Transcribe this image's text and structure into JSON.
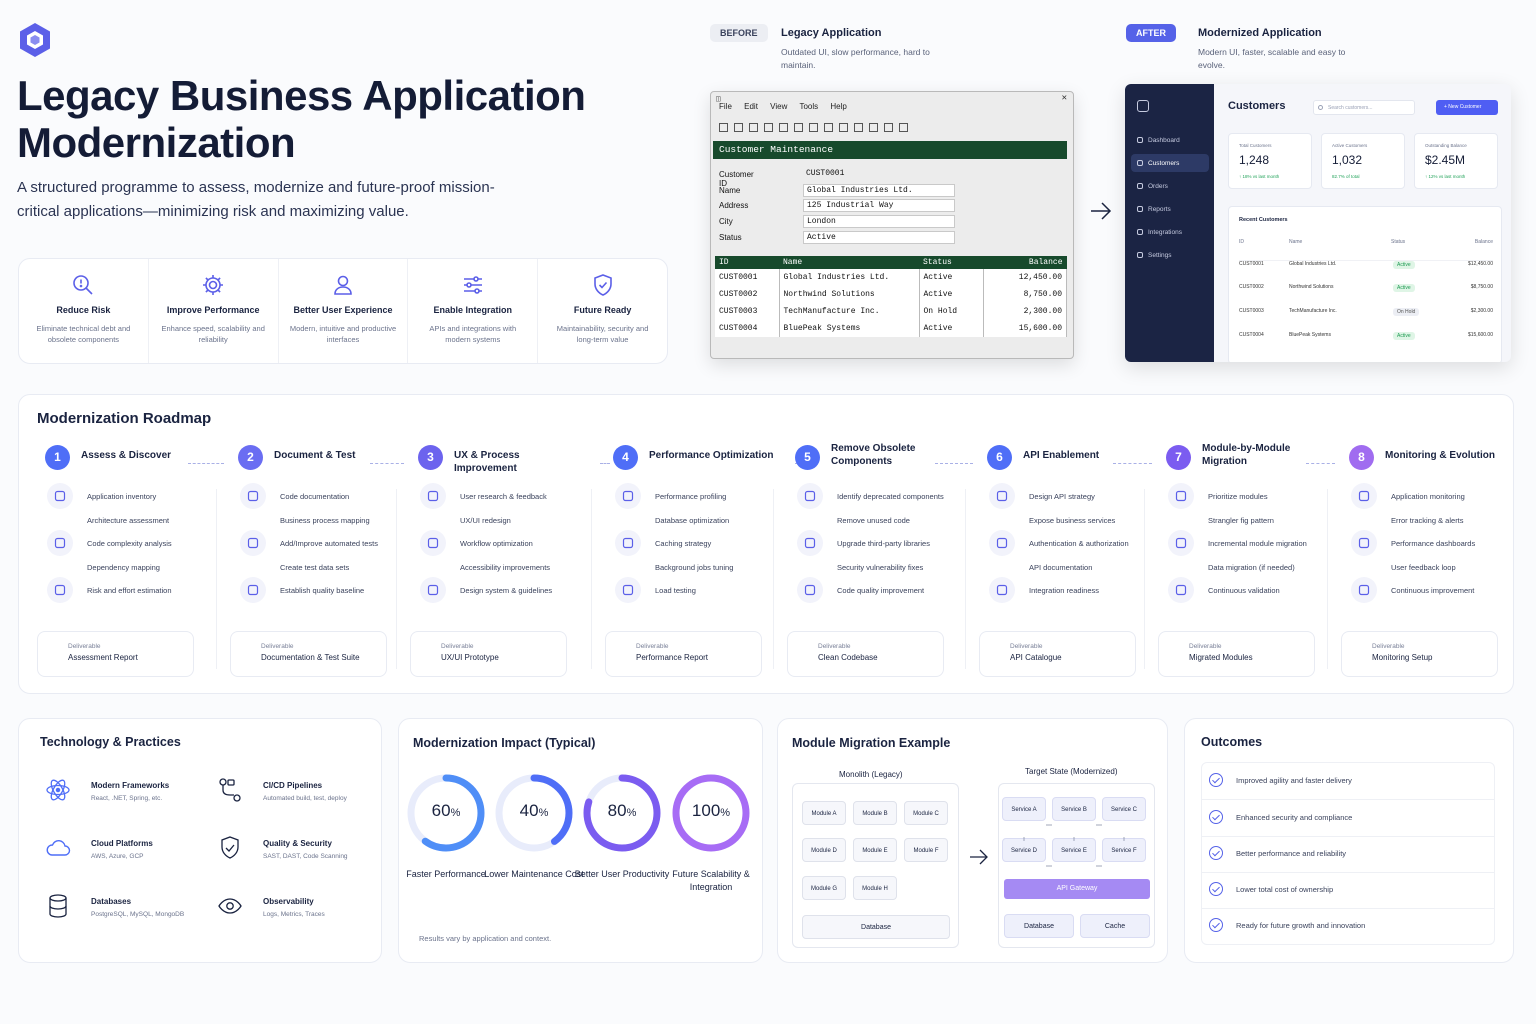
{
  "hero": {
    "title_line1": "Legacy Business Application",
    "title_line2": "Modernization",
    "lead": "A structured programme to assess, modernize and future-proof mission-critical applications—minimizing risk and maximizing value.",
    "goals": [
      {
        "icon": "search-risk-icon",
        "title": "Reduce Risk",
        "desc": "Eliminate technical debt and obsolete components"
      },
      {
        "icon": "gear-icon",
        "title": "Improve Performance",
        "desc": "Enhance speed, scalability and reliability"
      },
      {
        "icon": "user-icon",
        "title": "Better User Experience",
        "desc": "Modern, intuitive and productive interfaces"
      },
      {
        "icon": "sliders-icon",
        "title": "Enable Integration",
        "desc": "APIs and integrations with modern systems"
      },
      {
        "icon": "shield-check-icon",
        "title": "Future Ready",
        "desc": "Maintainability, security and long-term value"
      }
    ]
  },
  "before": {
    "pill": "BEFORE",
    "title": "Legacy Application",
    "desc": "Outdated UI, slow performance, hard to maintain.",
    "menu": [
      "File",
      "Edit",
      "View",
      "Tools",
      "Help"
    ],
    "window_title": "Customer Maintenance",
    "form": [
      {
        "label": "Customer ID",
        "value": "CUST0001",
        "boxed": false
      },
      {
        "label": "Name",
        "value": "Global Industries Ltd.",
        "boxed": true
      },
      {
        "label": "Address",
        "value": "125 Industrial Way",
        "boxed": true
      },
      {
        "label": "City",
        "value": "London",
        "boxed": true
      },
      {
        "label": "Status",
        "value": "Active",
        "boxed": true
      }
    ],
    "columns": [
      "ID",
      "Name",
      "Status",
      "Balance"
    ],
    "rows": [
      [
        "CUST0001",
        "Global Industries Ltd.",
        "Active",
        "12,450.00"
      ],
      [
        "CUST0002",
        "Northwind Solutions",
        "Active",
        "8,750.00"
      ],
      [
        "CUST0003",
        "TechManufacture Inc.",
        "On Hold",
        "2,300.00"
      ],
      [
        "CUST0004",
        "BluePeak Systems",
        "Active",
        "15,600.00"
      ]
    ]
  },
  "after": {
    "pill": "AFTER",
    "title": "Modernized Application",
    "desc": "Modern UI, faster, scalable and easy to evolve.",
    "nav": [
      "Dashboard",
      "Customers",
      "Orders",
      "Reports",
      "Integrations",
      "Settings"
    ],
    "page_title": "Customers",
    "search_placeholder": "Search customers...",
    "new_button": "+ New Customer",
    "kpis": [
      {
        "label": "Total Customers",
        "value": "1,248",
        "sub": "↑ 18% vs last month"
      },
      {
        "label": "Active Customers",
        "value": "1,032",
        "sub": "82.7% of total"
      },
      {
        "label": "Outstanding Balance",
        "value": "$2.45M",
        "sub": "↑ 12% vs last month"
      }
    ],
    "recent_title": "Recent Customers",
    "columns": [
      "ID",
      "Name",
      "Status",
      "Balance"
    ],
    "rows": [
      [
        "CUST0001",
        "Global Industries Ltd.",
        "Active",
        "$12,450.00"
      ],
      [
        "CUST0002",
        "Northwind Solutions",
        "Active",
        "$8,750.00"
      ],
      [
        "CUST0003",
        "TechManufacture Inc.",
        "On Hold",
        "$2,300.00"
      ],
      [
        "CUST0004",
        "BluePeak Systems",
        "Active",
        "$15,600.00"
      ]
    ]
  },
  "roadmap": {
    "title": "Modernization Roadmap",
    "stages": [
      {
        "num": "1",
        "title": "Assess & Discover",
        "color": "#4f6ef7",
        "items": [
          "Application inventory",
          "Architecture assessment",
          "Code complexity analysis",
          "Dependency mapping",
          "Risk and effort estimation"
        ],
        "deliverable": "Assessment Report"
      },
      {
        "num": "2",
        "title": "Document & Test",
        "color": "#6a6df2",
        "items": [
          "Code documentation",
          "Business process mapping",
          "Add/Improve automated tests",
          "Create test data sets",
          "Establish quality baseline"
        ],
        "deliverable": "Documentation & Test Suite"
      },
      {
        "num": "3",
        "title": "UX & Process Improvement",
        "color": "#6c63ee",
        "items": [
          "User research & feedback",
          "UX/UI redesign",
          "Workflow optimization",
          "Accessibility improvements",
          "Design system & guidelines"
        ],
        "deliverable": "UX/UI Prototype"
      },
      {
        "num": "4",
        "title": "Performance Optimization",
        "color": "#4f6ef7",
        "items": [
          "Performance profiling",
          "Database optimization",
          "Caching strategy",
          "Background jobs tuning",
          "Load testing"
        ],
        "deliverable": "Performance Report"
      },
      {
        "num": "5",
        "title": "Remove Obsolete Components",
        "color": "#4f6ef7",
        "items": [
          "Identify deprecated components",
          "Remove unused code",
          "Upgrade third-party libraries",
          "Security vulnerability fixes",
          "Code quality improvement"
        ],
        "deliverable": "Clean Codebase"
      },
      {
        "num": "6",
        "title": "API Enablement",
        "color": "#4f6ef7",
        "items": [
          "Design API strategy",
          "Expose business services",
          "Authentication & authorization",
          "API documentation",
          "Integration readiness"
        ],
        "deliverable": "API Catalogue"
      },
      {
        "num": "7",
        "title": "Module-by-Module Migration",
        "color": "#7b5cf0",
        "items": [
          "Prioritize modules",
          "Strangler fig pattern",
          "Incremental module migration",
          "Data migration (if needed)",
          "Continuous validation"
        ],
        "deliverable": "Migrated Modules"
      },
      {
        "num": "8",
        "title": "Monitoring & Evolution",
        "color": "#a06cf0",
        "items": [
          "Application monitoring",
          "Error tracking & alerts",
          "Performance dashboards",
          "User feedback loop",
          "Continuous improvement"
        ],
        "deliverable": "Monitoring Setup"
      }
    ],
    "deliverable_label": "Deliverable"
  },
  "tech": {
    "title": "Technology & Practices",
    "items": [
      {
        "icon": "atom-icon",
        "title": "Modern Frameworks",
        "desc": "React, .NET, Spring, etc."
      },
      {
        "icon": "pipeline-icon",
        "title": "CI/CD Pipelines",
        "desc": "Automated build, test, deploy"
      },
      {
        "icon": "cloud-icon",
        "title": "Cloud Platforms",
        "desc": "AWS, Azure, GCP"
      },
      {
        "icon": "shield-check-icon",
        "title": "Quality & Security",
        "desc": "SAST, DAST, Code Scanning"
      },
      {
        "icon": "database-icon",
        "title": "Databases",
        "desc": "PostgreSQL, MySQL, MongoDB"
      },
      {
        "icon": "eye-icon",
        "title": "Observability",
        "desc": "Logs, Metrics, Traces"
      }
    ]
  },
  "impact": {
    "title": "Modernization Impact (Typical)",
    "metrics": [
      {
        "value": "60",
        "unit": "%",
        "fraction": 0.6,
        "label": "Faster Performance",
        "color": "#4f8ef7"
      },
      {
        "value": "40",
        "unit": "%",
        "fraction": 0.4,
        "label": "Lower Maintenance Cost",
        "color": "#4f6ef7"
      },
      {
        "value": "80",
        "unit": "%",
        "fraction": 0.8,
        "label": "Better User Productivity",
        "color": "#7b5cf0"
      },
      {
        "value": "100",
        "unit": "%",
        "fraction": 1.0,
        "label": "Future Scalability & Integration",
        "color": "#a76cf5"
      }
    ],
    "note": "Results vary by application and context."
  },
  "migration": {
    "title": "Module Migration Example",
    "legacy_title": "Monolith (Legacy)",
    "legacy_modules": [
      "Module A",
      "Module B",
      "Module C",
      "Module D",
      "Module E",
      "Module F",
      "Module G",
      "Module H"
    ],
    "legacy_db": "Database",
    "target_title": "Target State (Modernized)",
    "services": [
      "Service A",
      "Service B",
      "Service C",
      "Service D",
      "Service E",
      "Service F"
    ],
    "gateway": "API Gateway",
    "target_db": "Database",
    "cache": "Cache"
  },
  "outcomes": {
    "title": "Outcomes",
    "items": [
      "Improved agility and faster delivery",
      "Enhanced security and compliance",
      "Better performance and reliability",
      "Lower total cost of ownership",
      "Ready for future growth and innovation"
    ]
  }
}
